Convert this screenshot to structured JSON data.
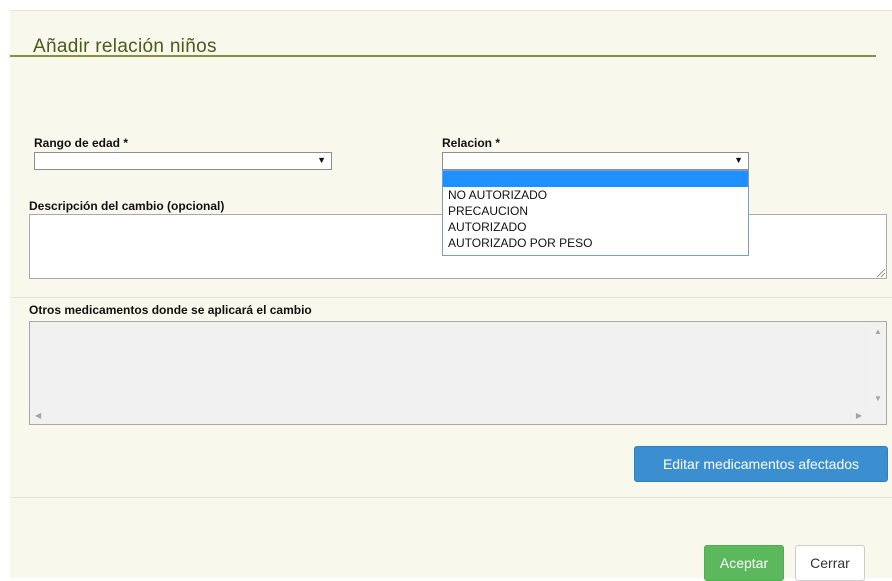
{
  "dialog": {
    "title": "Añadir relación niños"
  },
  "form": {
    "age_range_label": "Rango de edad *",
    "age_range_value": "",
    "relation_label": "Relacion *",
    "relation_value": "",
    "relation_options": [
      "",
      "NO AUTORIZADO",
      "PRECAUCION",
      "AUTORIZADO",
      "AUTORIZADO POR PESO"
    ],
    "description_label": "Descripción del cambio (opcional)",
    "description_value": "",
    "other_meds_label": "Otros medicamentos donde se aplicará el cambio"
  },
  "buttons": {
    "edit_affected": "Editar medicamentos afectados",
    "accept": "Aceptar",
    "close": "Cerrar"
  },
  "colors": {
    "panel_bg": "#f8f8ed",
    "title_text": "#4d5b1a",
    "title_rule": "#8a8f3c",
    "primary_blue": "#3b8fd1",
    "success_green": "#5cb85c",
    "dropdown_highlight": "#1e90ff"
  },
  "icons": {
    "select_arrow": "dropdown-arrow-icon",
    "resize_grip": "resize-grip-icon",
    "scroll_up": "scroll-up-icon",
    "scroll_down": "scroll-down-icon",
    "scroll_left": "scroll-left-icon",
    "scroll_right": "scroll-right-icon"
  }
}
